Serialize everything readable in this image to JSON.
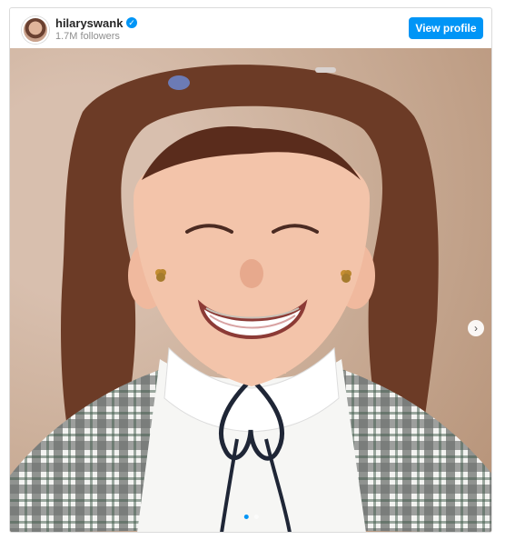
{
  "header": {
    "username": "hilaryswank",
    "followers": "1.7M followers",
    "verified_icon": "verified-badge-icon",
    "view_profile_label": "View profile"
  },
  "carousel": {
    "next_icon": "chevron-right-icon",
    "active_index": 1,
    "count": 2
  },
  "colors": {
    "accent": "#0095f6",
    "border": "#dbdbdb"
  }
}
